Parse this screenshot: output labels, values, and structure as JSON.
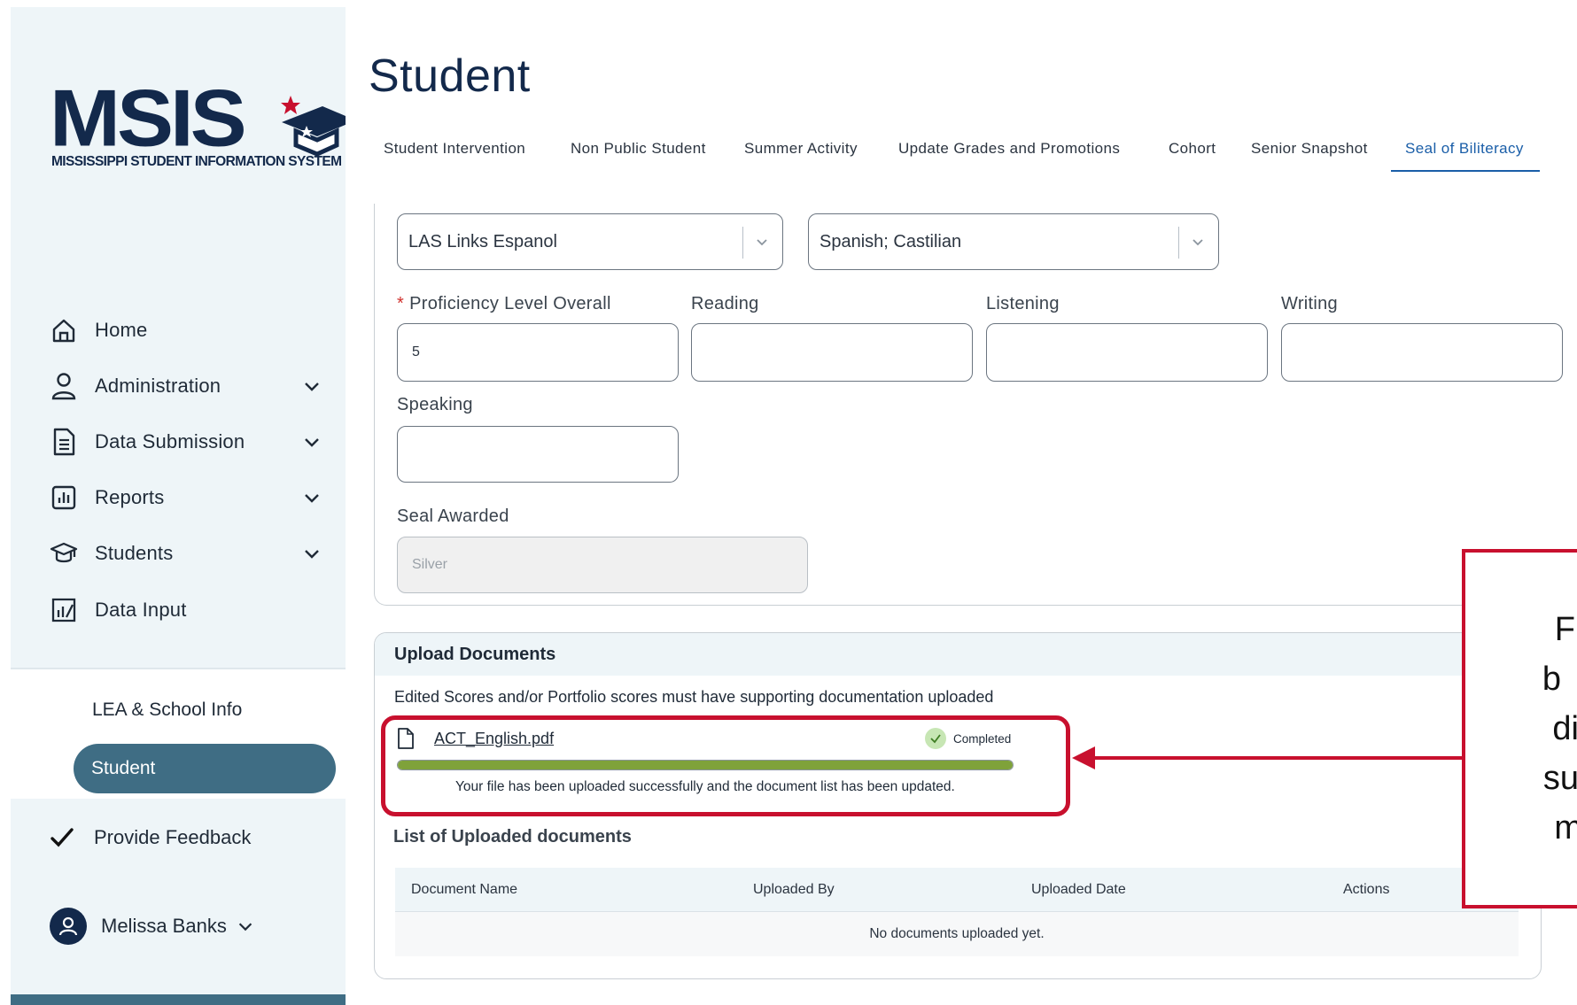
{
  "brand": {
    "logo_text": "MSIS",
    "logo_subtitle": "MISSISSIPPI STUDENT INFORMATION SYSTEM",
    "navy": "#13294b",
    "accent": "#3f6d84"
  },
  "sidebar": {
    "items": [
      {
        "label": "Home",
        "icon": "home-icon"
      },
      {
        "label": "Administration",
        "icon": "person-icon"
      },
      {
        "label": "Data Submission",
        "icon": "document-icon"
      },
      {
        "label": "Reports",
        "icon": "bar-chart-icon"
      },
      {
        "label": "Students",
        "icon": "graduation-cap-icon"
      },
      {
        "label": "Data Input",
        "icon": "data-input-icon"
      }
    ],
    "subitems": [
      {
        "label": "LEA & School Info"
      },
      {
        "label": "Student"
      }
    ],
    "feedback": "Provide Feedback",
    "user": "Melissa Banks"
  },
  "main": {
    "title": "Student",
    "tabs": [
      "Student Intervention",
      "Non Public Student",
      "Summer Activity",
      "Update Grades and Promotions",
      "Cohort",
      "Senior Snapshot",
      "Seal of Biliteracy"
    ],
    "active_tab": "Seal of Biliteracy"
  },
  "form": {
    "assessment": "LAS Links Espanol",
    "language": "Spanish; Castilian",
    "required_mark": "*",
    "proficiency_label": "Proficiency Level Overall",
    "proficiency_value": "5",
    "reading_label": "Reading",
    "listening_label": "Listening",
    "writing_label": "Writing",
    "speaking_label": "Speaking",
    "seal_label": "Seal Awarded",
    "seal_value": "Silver"
  },
  "upload": {
    "header": "Upload Documents",
    "note": "Edited Scores and/or Portfolio scores must have supporting documentation uploaded",
    "file_name": "ACT_English.pdf",
    "status": "Completed",
    "progress_percent": 100,
    "message": "Your file has been uploaded successfully and the document list has been updated.",
    "list_title": "List of Uploaded documents",
    "columns": [
      "Document Name",
      "Uploaded By",
      "Uploaded Date",
      "Actions"
    ],
    "empty": "No documents uploaded yet."
  },
  "callout": {
    "lines": [
      "F",
      "b",
      "di",
      "su",
      "m"
    ],
    "color": "#c8102e"
  }
}
